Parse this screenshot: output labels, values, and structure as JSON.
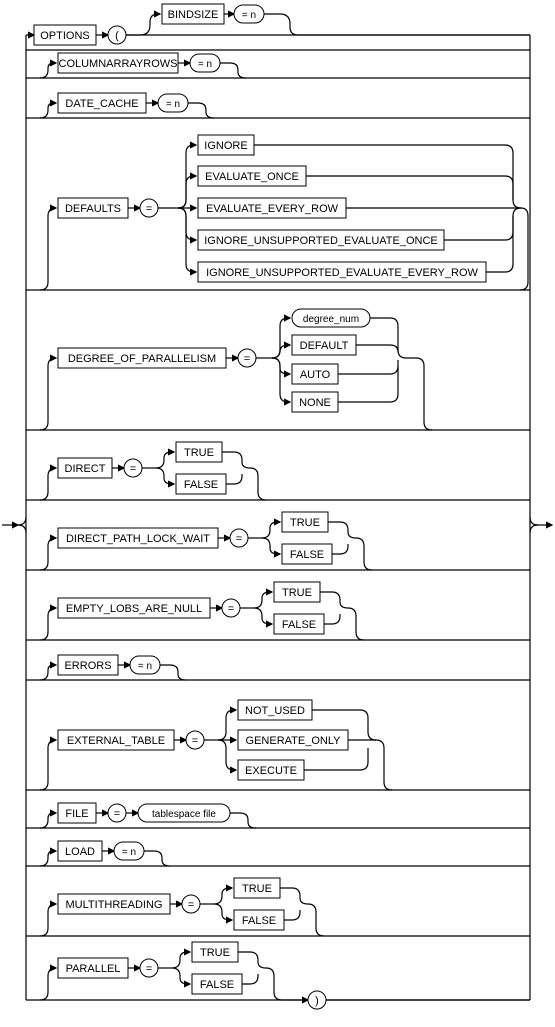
{
  "entry": {
    "keyword": "OPTIONS",
    "lparen": "(",
    "rparen": ")"
  },
  "opts": {
    "bindsize": {
      "kw": "BINDSIZE",
      "val": "= n"
    },
    "car": {
      "kw": "COLUMNARRAYROWS",
      "val": "= n"
    },
    "datecache": {
      "kw": "DATE_CACHE",
      "val": "= n"
    },
    "defaults": {
      "kw": "DEFAULTS",
      "eq": "=",
      "choices": [
        "IGNORE",
        "EVALUATE_ONCE",
        "EVALUATE_EVERY_ROW",
        "IGNORE_UNSUPPORTED_EVALUATE_ONCE",
        "IGNORE_UNSUPPORTED_EVALUATE_EVERY_ROW"
      ]
    },
    "dop": {
      "kw": "DEGREE_OF_PARALLELISM",
      "eq": "=",
      "choices": [
        "degree_num",
        "DEFAULT",
        "AUTO",
        "NONE"
      ]
    },
    "direct": {
      "kw": "DIRECT",
      "eq": "=",
      "tf": [
        "TRUE",
        "FALSE"
      ]
    },
    "dplw": {
      "kw": "DIRECT_PATH_LOCK_WAIT",
      "eq": "=",
      "tf": [
        "TRUE",
        "FALSE"
      ]
    },
    "elobs": {
      "kw": "EMPTY_LOBS_ARE_NULL",
      "eq": "=",
      "tf": [
        "TRUE",
        "FALSE"
      ]
    },
    "errors": {
      "kw": "ERRORS",
      "val": "= n"
    },
    "ext": {
      "kw": "EXTERNAL_TABLE",
      "eq": "=",
      "choices": [
        "NOT_USED",
        "GENERATE_ONLY",
        "EXECUTE"
      ]
    },
    "file": {
      "kw": "FILE",
      "eq": "=",
      "val": "tablespace file"
    },
    "load": {
      "kw": "LOAD",
      "val": "= n"
    },
    "mt": {
      "kw": "MULTITHREADING",
      "eq": "=",
      "tf": [
        "TRUE",
        "FALSE"
      ]
    },
    "parallel": {
      "kw": "PARALLEL",
      "eq": "=",
      "tf": [
        "TRUE",
        "FALSE"
      ]
    }
  },
  "chart_data": {
    "type": "railroad-syntax-diagram",
    "entry_keyword": "OPTIONS",
    "wrapped_in_parentheses": true,
    "options": [
      {
        "name": "BINDSIZE",
        "value_type": "= n"
      },
      {
        "name": "COLUMNARRAYROWS",
        "value_type": "= n"
      },
      {
        "name": "DATE_CACHE",
        "value_type": "= n"
      },
      {
        "name": "DEFAULTS",
        "equals": true,
        "choices": [
          "IGNORE",
          "EVALUATE_ONCE",
          "EVALUATE_EVERY_ROW",
          "IGNORE_UNSUPPORTED_EVALUATE_ONCE",
          "IGNORE_UNSUPPORTED_EVALUATE_EVERY_ROW"
        ]
      },
      {
        "name": "DEGREE_OF_PARALLELISM",
        "equals": true,
        "choices": [
          "degree_num",
          "DEFAULT",
          "AUTO",
          "NONE"
        ]
      },
      {
        "name": "DIRECT",
        "equals": true,
        "choices": [
          "TRUE",
          "FALSE"
        ]
      },
      {
        "name": "DIRECT_PATH_LOCK_WAIT",
        "equals": true,
        "choices": [
          "TRUE",
          "FALSE"
        ]
      },
      {
        "name": "EMPTY_LOBS_ARE_NULL",
        "equals": true,
        "choices": [
          "TRUE",
          "FALSE"
        ]
      },
      {
        "name": "ERRORS",
        "value_type": "= n"
      },
      {
        "name": "EXTERNAL_TABLE",
        "equals": true,
        "choices": [
          "NOT_USED",
          "GENERATE_ONLY",
          "EXECUTE"
        ]
      },
      {
        "name": "FILE",
        "equals": true,
        "value_type": "tablespace file"
      },
      {
        "name": "LOAD",
        "value_type": "= n"
      },
      {
        "name": "MULTITHREADING",
        "equals": true,
        "choices": [
          "TRUE",
          "FALSE"
        ]
      },
      {
        "name": "PARALLEL",
        "equals": true,
        "choices": [
          "TRUE",
          "FALSE"
        ]
      }
    ]
  }
}
